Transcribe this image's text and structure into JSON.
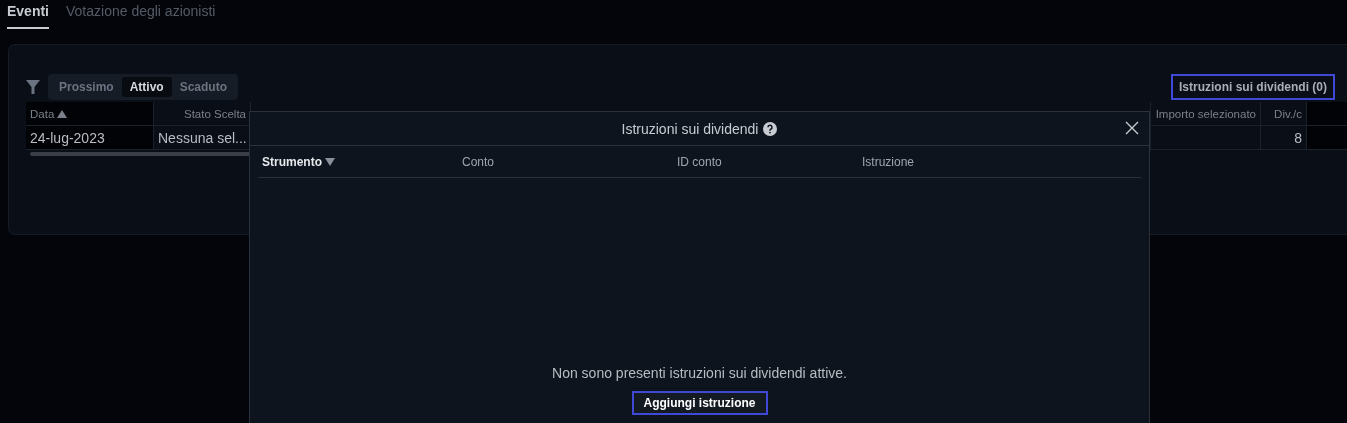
{
  "tabs": [
    {
      "label": "Eventi",
      "selected": true
    },
    {
      "label": "Votazione degli azionisti",
      "selected": false
    }
  ],
  "filters": [
    {
      "label": "Prossimo",
      "selected": false
    },
    {
      "label": "Attivo",
      "selected": true
    },
    {
      "label": "Scaduto",
      "selected": false
    }
  ],
  "instructions_button": "Istruzioni sui dividendi (0)",
  "table": {
    "columns": [
      {
        "label": "Data",
        "sorted": true,
        "sort_descending": false
      },
      {
        "label": "Stato Scelta"
      },
      {
        "label": "Importo selezionato"
      },
      {
        "label": "Div./c"
      }
    ],
    "rows": [
      {
        "cells": [
          "24-lug-2023",
          "Nessuna sel...",
          "",
          "8"
        ]
      }
    ]
  },
  "dialog": {
    "title": "Istruzioni sui dividendi",
    "columns": [
      {
        "label": "Strumento",
        "sorted": true,
        "sort_descending": true
      },
      {
        "label": "Conto"
      },
      {
        "label": "ID conto"
      },
      {
        "label": "Istruzione"
      }
    ],
    "empty_message": "Non sono presenti istruzioni sui dividendi attive.",
    "add_button": "Aggiungi istruzione"
  }
}
